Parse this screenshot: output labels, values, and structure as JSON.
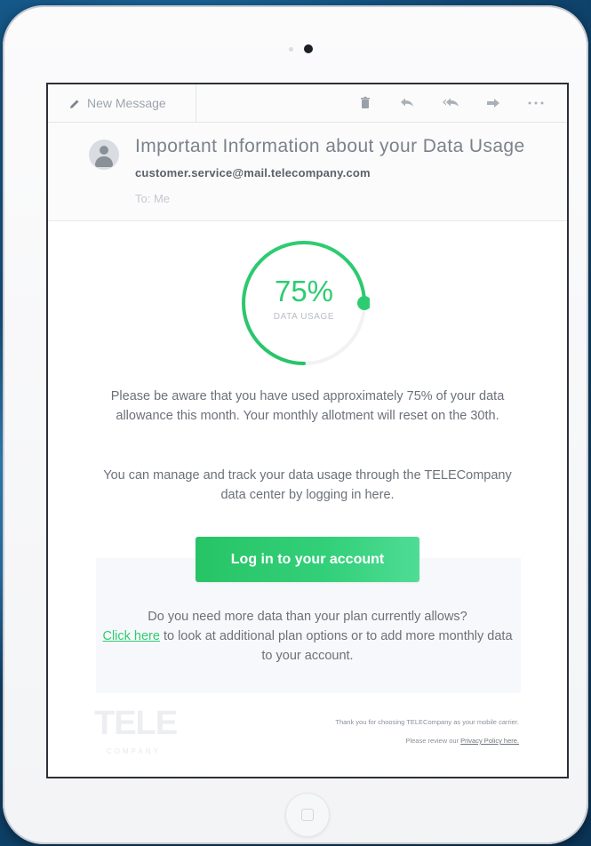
{
  "toolbar": {
    "new_message_label": "New Message",
    "icons": [
      "trash-icon",
      "reply-icon",
      "reply-all-icon",
      "forward-icon",
      "more-icon"
    ]
  },
  "email": {
    "subject": "Important Information about your Data Usage",
    "sender": "customer.service@mail.telecompany.com",
    "recipient": "To: Me"
  },
  "usage": {
    "percent_text": "75%",
    "label": "DATA USAGE",
    "fraction": 0.75,
    "accent_color": "#2ecc71"
  },
  "body": {
    "paragraph1": "Please be aware that you have used approximately 75% of your data allowance this month. Your monthly allotment will reset on the 30th.",
    "paragraph2": "You can manage and track your data usage through the TELECompany data center by logging in here.",
    "login_button": "Log in to your account",
    "promo_before": "Do you need more data than your plan currently allows?",
    "promo_link": "Click here",
    "promo_after": " to look at additional plan options or to add more monthly data to your account."
  },
  "footer": {
    "logo_text": "TELE",
    "logo_sub": "COMPANY",
    "thanks": "Thank you for choosing TELECompany as your mobile carrier.",
    "review_prefix": "Please review our ",
    "privacy_link": "Privacy Policy here."
  }
}
